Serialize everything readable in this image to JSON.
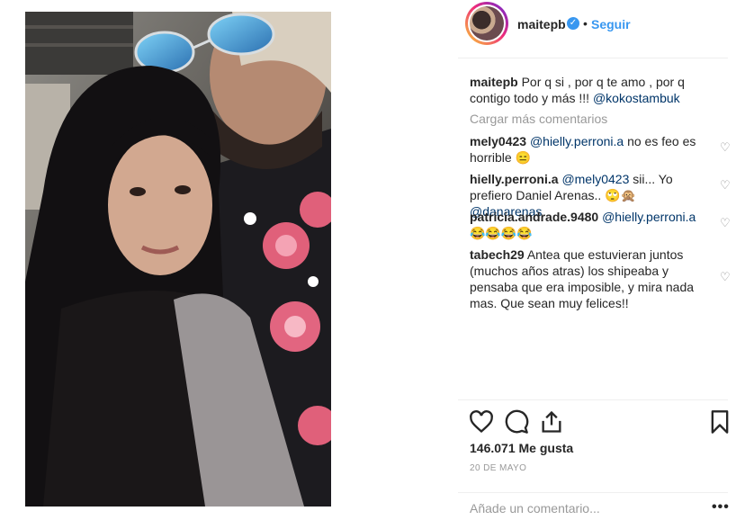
{
  "post": {
    "username": "maitepb",
    "verified_mark": "✓",
    "dot": "•",
    "follow_label": "Seguir"
  },
  "caption": {
    "username": "maitepb",
    "text": "Por q si , por q te amo , por q contigo todo y más !!! ",
    "mention": "@kokostambuk"
  },
  "load_more": "Cargar más comentarios",
  "comments": [
    {
      "username": "mely0423",
      "mention": "@hielly.perroni.a",
      "text": " no es feo es horrible 😑"
    },
    {
      "username": "hielly.perroni.a",
      "mention": "@mely0423",
      "text": " sii... Yo prefiero Daniel Arenas.. 🙄🙊 ",
      "mention2": "@danarenas"
    },
    {
      "username": "patricia.andrade.9480",
      "mention": "@hielly.perroni.a",
      "text": " 😂😂😂😂"
    },
    {
      "username": "tabech29",
      "text": "Antea que estuvieran juntos (muchos años atras) los shipeaba y pensaba que era imposible, y mira nada mas. Que sean muy felices!!"
    }
  ],
  "likes": "146.071 Me gusta",
  "date": "20 DE MAYO",
  "add_comment_placeholder": "Añade un comentario...",
  "more_dots": "•••",
  "icons": {
    "like": "heart-icon",
    "comment": "comment-icon",
    "share": "share-icon",
    "save": "bookmark-icon",
    "comment_like": "heart-icon"
  },
  "colors": {
    "link_blue": "#3897f0",
    "mention_blue": "#003569",
    "muted": "#999999",
    "text": "#262626"
  }
}
